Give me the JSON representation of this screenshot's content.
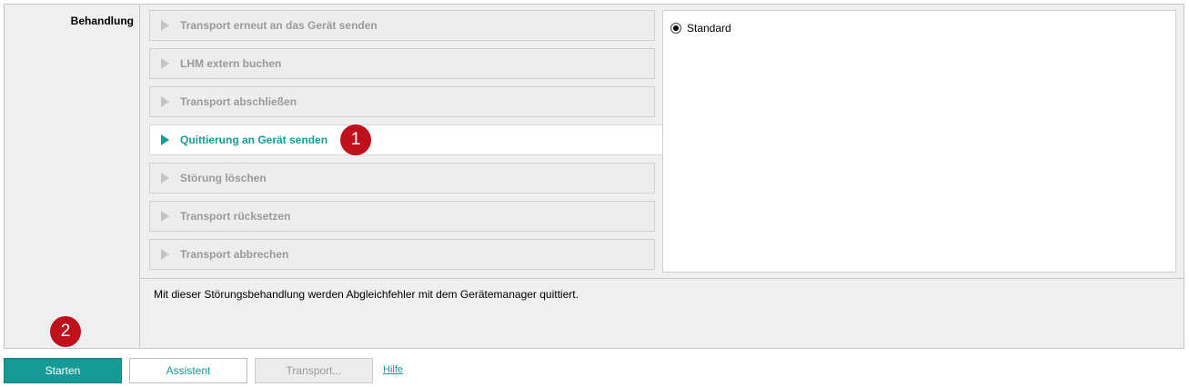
{
  "section": {
    "label": "Behandlung"
  },
  "options": [
    {
      "label": "Transport erneut an das Gerät senden",
      "selected": false
    },
    {
      "label": "LHM extern buchen",
      "selected": false
    },
    {
      "label": "Transport abschließen",
      "selected": false
    },
    {
      "label": "Quittierung an Gerät senden",
      "selected": true
    },
    {
      "label": "Störung löschen",
      "selected": false
    },
    {
      "label": "Transport rücksetzen",
      "selected": false
    },
    {
      "label": "Transport abbrechen",
      "selected": false
    }
  ],
  "details": {
    "radio_label": "Standard",
    "radio_checked": true
  },
  "description": "Mit dieser Störungsbehandlung werden Abgleichfehler mit dem Gerätemanager quittiert.",
  "markers": {
    "one": "1",
    "two": "2"
  },
  "footer": {
    "start_label": "Starten",
    "assist_label": "Assistent",
    "transport_label": "Transport...",
    "help_label": "Hilfe"
  },
  "colors": {
    "accent": "#159a98",
    "marker": "#c0101c",
    "panel_bg": "#efefef",
    "disabled_text": "#9a9a9a"
  },
  "icons": {
    "option_arrow": "triangle-right-icon",
    "radio": "radio-selected-icon"
  }
}
